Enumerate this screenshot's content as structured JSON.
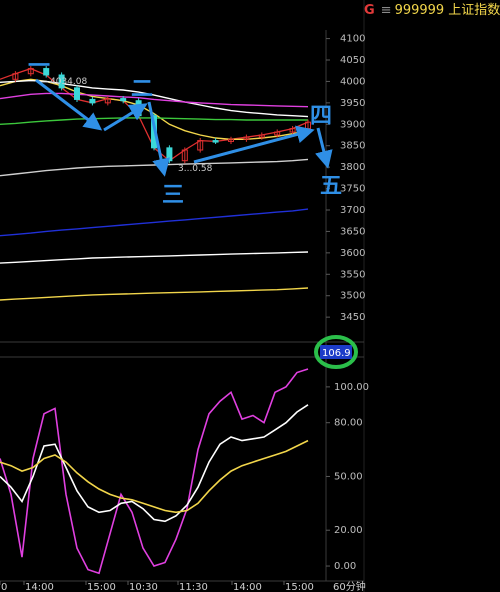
{
  "header": {
    "marker": "G",
    "menu_glyph": "≡",
    "code": "999999",
    "name": "上证指数"
  },
  "price_axis": {
    "ticks": [
      "4100",
      "4050",
      "4000",
      "3950",
      "3900",
      "3850",
      "3800",
      "3750",
      "3700",
      "3650",
      "3600",
      "3550",
      "3500",
      "3450"
    ]
  },
  "indicator_axis": {
    "ticks": [
      "100.00",
      "80.00",
      "50.00",
      "20.00",
      "0.00"
    ],
    "current_value": "106.9"
  },
  "time_axis": {
    "labels": [
      "0",
      "14:00",
      "15:00",
      "10:30",
      "11:30",
      "14:00",
      "15:00"
    ],
    "period": "60分钟"
  },
  "price_annotations": {
    "high": "4034.08",
    "low": "3...0.58"
  },
  "wave_labels": [
    "一",
    "二",
    "三",
    "四",
    "五"
  ],
  "colors": {
    "background": "#000000",
    "annotation": "#2f8fe6",
    "highlight_circle": "#2bbf4a",
    "value_box": "#1c3cc8",
    "yellow": "#f2d64b",
    "magenta": "#e040e0",
    "white": "#ffffff",
    "green": "#3cc83c",
    "blue": "#2030d8",
    "red": "#e03030"
  },
  "chart_data": [
    {
      "type": "line",
      "title": "",
      "xlabel": "",
      "ylabel": "",
      "ylim": [
        3420,
        4120
      ],
      "series": [
        {
          "x": [
            0,
            1,
            2,
            3,
            4,
            5,
            6,
            7,
            8,
            9,
            10,
            11,
            12,
            13,
            14,
            15,
            16,
            17,
            18,
            19,
            20
          ],
          "values": [
            4005,
            4018,
            4030,
            4015,
            3985,
            3958,
            3950,
            3960,
            3955,
            3920,
            3845,
            3815,
            3840,
            3862,
            3860,
            3865,
            3870,
            3875,
            3882,
            3890,
            3905
          ]
        },
        {
          "x": [
            0,
            1,
            2,
            3,
            4,
            5,
            6,
            7,
            8,
            9,
            10,
            11,
            12,
            13,
            14,
            15,
            16,
            17,
            18,
            19,
            20
          ],
          "values": [
            3990,
            4000,
            4005,
            4000,
            3990,
            3975,
            3965,
            3960,
            3955,
            3945,
            3925,
            3900,
            3885,
            3875,
            3868,
            3865,
            3865,
            3868,
            3872,
            3878,
            3885
          ]
        },
        {
          "x": [
            0,
            1,
            2,
            3,
            4,
            5,
            6,
            7,
            8,
            9,
            10,
            11,
            12,
            13,
            14,
            15,
            16,
            17,
            18,
            19,
            20
          ],
          "values": [
            3998,
            4000,
            4002,
            4000,
            3995,
            3990,
            3985,
            3982,
            3980,
            3975,
            3968,
            3960,
            3952,
            3945,
            3938,
            3932,
            3928,
            3925,
            3922,
            3920,
            3918
          ]
        },
        {
          "x": [
            0,
            1,
            2,
            3,
            4,
            5,
            6,
            7,
            8,
            9,
            10,
            11,
            12,
            13,
            14,
            15,
            16,
            17,
            18,
            19,
            20
          ],
          "values": [
            3960,
            3965,
            3970,
            3972,
            3972,
            3970,
            3968,
            3966,
            3964,
            3962,
            3958,
            3955,
            3952,
            3950,
            3948,
            3946,
            3945,
            3944,
            3943,
            3942,
            3941
          ]
        },
        {
          "x": [
            0,
            1,
            2,
            3,
            4,
            5,
            6,
            7,
            8,
            9,
            10,
            11,
            12,
            13,
            14,
            15,
            16,
            17,
            18,
            19,
            20
          ],
          "values": [
            3900,
            3902,
            3905,
            3908,
            3910,
            3912,
            3913,
            3914,
            3915,
            3915,
            3915,
            3914,
            3913,
            3912,
            3911,
            3911,
            3910,
            3910,
            3910,
            3910,
            3910
          ]
        },
        {
          "x": [
            0,
            1,
            2,
            3,
            4,
            5,
            6,
            7,
            8,
            9,
            10,
            11,
            12,
            13,
            14,
            15,
            16,
            17,
            18,
            19,
            20
          ],
          "values": [
            3780,
            3784,
            3788,
            3792,
            3795,
            3798,
            3800,
            3802,
            3803,
            3804,
            3805,
            3806,
            3807,
            3808,
            3809,
            3810,
            3811,
            3812,
            3813,
            3815,
            3818
          ]
        },
        {
          "x": [
            0,
            1,
            2,
            3,
            4,
            5,
            6,
            7,
            8,
            9,
            10,
            11,
            12,
            13,
            14,
            15,
            16,
            17,
            18,
            19,
            20
          ],
          "values": [
            3640,
            3643,
            3646,
            3650,
            3653,
            3656,
            3659,
            3662,
            3665,
            3668,
            3671,
            3674,
            3677,
            3680,
            3683,
            3686,
            3689,
            3692,
            3695,
            3698,
            3702
          ]
        },
        {
          "x": [
            0,
            1,
            2,
            3,
            4,
            5,
            6,
            7,
            8,
            9,
            10,
            11,
            12,
            13,
            14,
            15,
            16,
            17,
            18,
            19,
            20
          ],
          "values": [
            3576,
            3578,
            3580,
            3582,
            3584,
            3586,
            3588,
            3589,
            3590,
            3591,
            3592,
            3593,
            3594,
            3595,
            3596,
            3597,
            3598,
            3599,
            3600,
            3601,
            3602
          ]
        },
        {
          "x": [
            0,
            1,
            2,
            3,
            4,
            5,
            6,
            7,
            8,
            9,
            10,
            11,
            12,
            13,
            14,
            15,
            16,
            17,
            18,
            19,
            20
          ],
          "values": [
            3490,
            3492,
            3494,
            3496,
            3498,
            3500,
            3502,
            3503,
            3504,
            3505,
            3506,
            3507,
            3508,
            3509,
            3510,
            3511,
            3512,
            3513,
            3514,
            3516,
            3518
          ]
        }
      ]
    },
    {
      "type": "line",
      "title": "",
      "ylim": [
        -5,
        115
      ],
      "series": [
        {
          "x": [
            0,
            1,
            2,
            3,
            4,
            5,
            6,
            7,
            8,
            9,
            10,
            11,
            12,
            13,
            14,
            15,
            16,
            17,
            18,
            19,
            20,
            21,
            22,
            23,
            24,
            25,
            26,
            27,
            28
          ],
          "values": [
            60,
            40,
            5,
            60,
            85,
            88,
            40,
            10,
            -2,
            -4,
            18,
            40,
            30,
            10,
            0,
            2,
            15,
            32,
            65,
            85,
            92,
            97,
            82,
            84,
            80,
            97,
            100,
            108,
            110
          ]
        },
        {
          "x": [
            0,
            1,
            2,
            3,
            4,
            5,
            6,
            7,
            8,
            9,
            10,
            11,
            12,
            13,
            14,
            15,
            16,
            17,
            18,
            19,
            20,
            21,
            22,
            23,
            24,
            25,
            26,
            27,
            28
          ],
          "values": [
            50,
            44,
            36,
            50,
            67,
            68,
            55,
            42,
            33,
            30,
            31,
            35,
            36,
            32,
            26,
            25,
            28,
            34,
            44,
            58,
            68,
            72,
            70,
            71,
            72,
            76,
            80,
            86,
            90
          ]
        },
        {
          "x": [
            0,
            1,
            2,
            3,
            4,
            5,
            6,
            7,
            8,
            9,
            10,
            11,
            12,
            13,
            14,
            15,
            16,
            17,
            18,
            19,
            20,
            21,
            22,
            23,
            24,
            25,
            26,
            27,
            28
          ],
          "values": [
            58,
            56,
            53,
            55,
            60,
            62,
            58,
            52,
            47,
            43,
            40,
            38,
            37,
            35,
            33,
            31,
            30,
            31,
            35,
            42,
            48,
            53,
            56,
            58,
            60,
            62,
            64,
            67,
            70
          ]
        }
      ]
    }
  ]
}
